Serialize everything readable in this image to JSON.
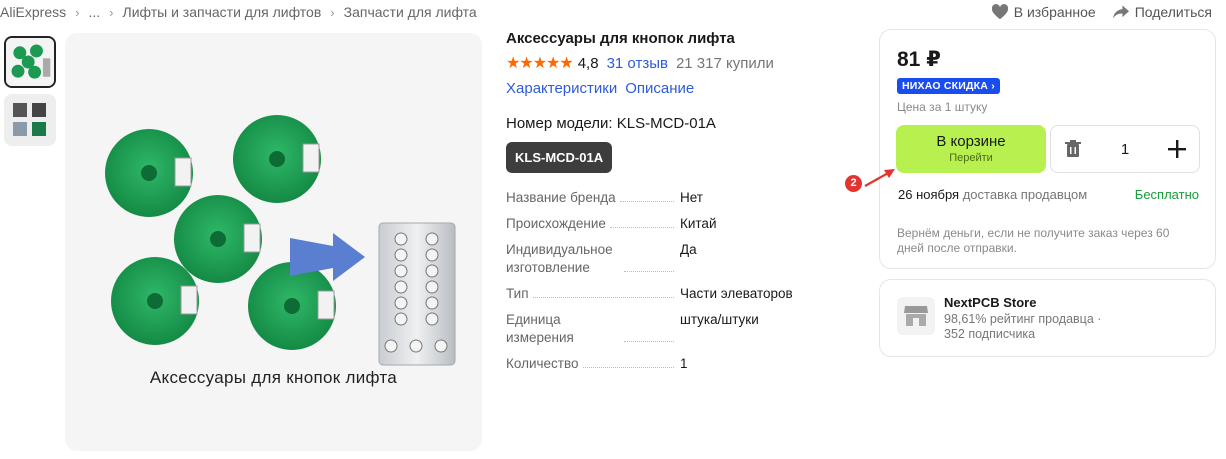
{
  "breadcrumb": {
    "items": [
      "AliExpress",
      "...",
      "Лифты и запчасти для лифтов",
      "Запчасти для лифта"
    ],
    "separator": "›"
  },
  "top_actions": {
    "favorites_label": "В избранное",
    "share_label": "Поделиться"
  },
  "gallery": {
    "caption": "Аксессуары для кнопок лифта",
    "thumbnails": 2
  },
  "product": {
    "title": "Аксессуары для кнопок лифта",
    "stars": "★★★★★",
    "rating": "4,8",
    "reviews": "31 отзыв",
    "sold": "21 317 купили",
    "links": [
      "Характеристики",
      "Описание"
    ],
    "model_label": "Номер модели: KLS-MCD-01A",
    "model_chip": "KLS-MCD-01A",
    "specs": [
      {
        "key": "Название бренда",
        "value": "Нет"
      },
      {
        "key": "Происхождение",
        "value": "Китай"
      },
      {
        "key": "Индивидуальное изготовление",
        "value": "Да"
      },
      {
        "key": "Тип",
        "value": "Части элеваторов"
      },
      {
        "key": "Единица измерения",
        "value": "штука/штуки"
      },
      {
        "key": "Количество",
        "value": "1"
      }
    ]
  },
  "buy_card": {
    "price": "81 ₽",
    "promo_badge": "НИХАО СКИДКА ›",
    "unit_price": "Цена за 1 штуку",
    "cart_button": "В корзине",
    "cart_button_sub": "Перейти",
    "quantity": "1",
    "delivery_date": "26 ноября",
    "delivery_text": "доставка продавцом",
    "delivery_cost": "Бесплатно",
    "refund_note": "Вернём деньги, если не получите заказ через 60 дней после отправки."
  },
  "annotation_badge": "2",
  "store": {
    "name": "NextPCB Store",
    "rating": "98,61% рейтинг продавца ·",
    "subscribers": "352 подписчика"
  },
  "colors": {
    "accent_blue": "#2e5cd8",
    "star_orange": "#ff6a00",
    "cart_green": "#b8f14f",
    "free_green": "#1a9d3b",
    "promo_blue": "#1a4df0",
    "badge_red": "#e3342f"
  }
}
